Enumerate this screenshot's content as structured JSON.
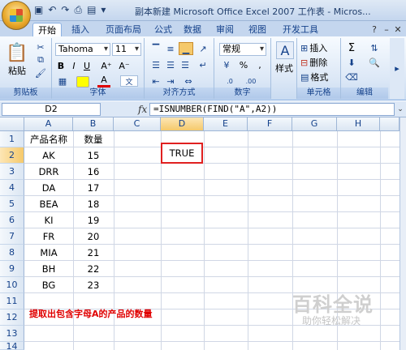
{
  "title": "副本新建 Microsoft Office Excel 2007 工作表 - Micros...",
  "tabs": [
    "开始",
    "插入",
    "页面布局",
    "公式",
    "数据",
    "审阅",
    "视图",
    "开发工具"
  ],
  "ribbon": {
    "paste_label": "粘贴",
    "font_name": "Tahoma",
    "font_size": "11",
    "bold": "B",
    "italic": "I",
    "underline": "U",
    "number_format": "常规",
    "style_label": "样式",
    "insert_label": "插入",
    "delete_label": "删除",
    "format_label": "格式",
    "groups": {
      "clipboard": "剪贴板",
      "font": "字体",
      "alignment": "对齐方式",
      "number": "数字",
      "cells": "单元格",
      "editing": "编辑"
    }
  },
  "formula_bar": {
    "name_box": "D2",
    "fx": "fx",
    "formula": "=ISNUMBER(FIND(\"A\",A2))"
  },
  "columns": [
    "A",
    "B",
    "C",
    "D",
    "E",
    "F",
    "G",
    "H"
  ],
  "rows": [
    "1",
    "2",
    "3",
    "4",
    "5",
    "6",
    "7",
    "8",
    "9",
    "10",
    "11",
    "12",
    "13",
    "14"
  ],
  "header": {
    "a1": "产品名称",
    "b1": "数量"
  },
  "products": [
    {
      "name": "AK",
      "qty": "15"
    },
    {
      "name": "DRR",
      "qty": "16"
    },
    {
      "name": "DA",
      "qty": "17"
    },
    {
      "name": "BEA",
      "qty": "18"
    },
    {
      "name": "KI",
      "qty": "19"
    },
    {
      "name": "FR",
      "qty": "20"
    },
    {
      "name": "MIA",
      "qty": "21"
    },
    {
      "name": "BH",
      "qty": "22"
    },
    {
      "name": "BG",
      "qty": "23"
    }
  ],
  "d2_value": "TRUE",
  "note": "提取出包含字母A的产品的数量",
  "watermark": {
    "main": "百科全说",
    "sub": "助你轻松解决"
  },
  "colors": {
    "accent": "#15428b",
    "highlight": "#e02020"
  }
}
